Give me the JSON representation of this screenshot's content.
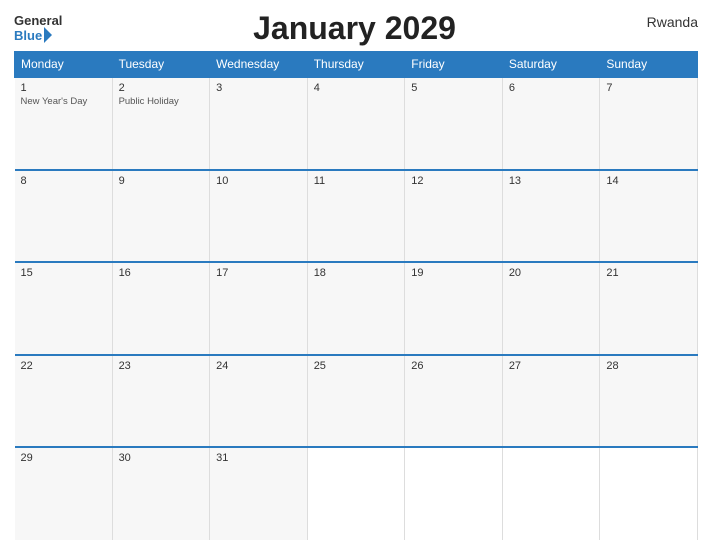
{
  "header": {
    "logo_general": "General",
    "logo_blue": "Blue",
    "title": "January 2029",
    "country": "Rwanda"
  },
  "calendar": {
    "days_of_week": [
      "Monday",
      "Tuesday",
      "Wednesday",
      "Thursday",
      "Friday",
      "Saturday",
      "Sunday"
    ],
    "weeks": [
      [
        {
          "day": "1",
          "holiday": "New Year's Day"
        },
        {
          "day": "2",
          "holiday": "Public Holiday"
        },
        {
          "day": "3",
          "holiday": ""
        },
        {
          "day": "4",
          "holiday": ""
        },
        {
          "day": "5",
          "holiday": ""
        },
        {
          "day": "6",
          "holiday": ""
        },
        {
          "day": "7",
          "holiday": ""
        }
      ],
      [
        {
          "day": "8",
          "holiday": ""
        },
        {
          "day": "9",
          "holiday": ""
        },
        {
          "day": "10",
          "holiday": ""
        },
        {
          "day": "11",
          "holiday": ""
        },
        {
          "day": "12",
          "holiday": ""
        },
        {
          "day": "13",
          "holiday": ""
        },
        {
          "day": "14",
          "holiday": ""
        }
      ],
      [
        {
          "day": "15",
          "holiday": ""
        },
        {
          "day": "16",
          "holiday": ""
        },
        {
          "day": "17",
          "holiday": ""
        },
        {
          "day": "18",
          "holiday": ""
        },
        {
          "day": "19",
          "holiday": ""
        },
        {
          "day": "20",
          "holiday": ""
        },
        {
          "day": "21",
          "holiday": ""
        }
      ],
      [
        {
          "day": "22",
          "holiday": ""
        },
        {
          "day": "23",
          "holiday": ""
        },
        {
          "day": "24",
          "holiday": ""
        },
        {
          "day": "25",
          "holiday": ""
        },
        {
          "day": "26",
          "holiday": ""
        },
        {
          "day": "27",
          "holiday": ""
        },
        {
          "day": "28",
          "holiday": ""
        }
      ],
      [
        {
          "day": "29",
          "holiday": ""
        },
        {
          "day": "30",
          "holiday": ""
        },
        {
          "day": "31",
          "holiday": ""
        },
        {
          "day": "",
          "holiday": ""
        },
        {
          "day": "",
          "holiday": ""
        },
        {
          "day": "",
          "holiday": ""
        },
        {
          "day": "",
          "holiday": ""
        }
      ]
    ]
  }
}
